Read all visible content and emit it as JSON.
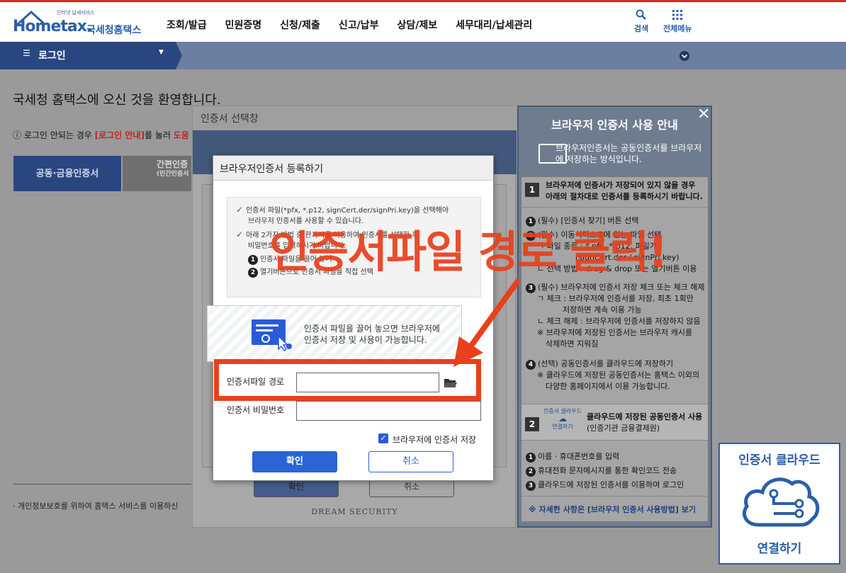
{
  "header": {
    "logo_small": "인터넷 납세서비스",
    "logo_main": "Hometax.",
    "logo_sub": "국세청홈택스",
    "nav": [
      "조회/발급",
      "민원증명",
      "신청/제출",
      "신고/납부",
      "상담/제보",
      "세무대리/납세관리"
    ],
    "search_label": "검색",
    "menu_label": "전체메뉴"
  },
  "subbar": {
    "login_label": "로그인"
  },
  "page": {
    "welcome": "국세청 홈택스에 오신 것을 환영합니다.",
    "info_pre": "로그인 안되는 경우 ",
    "info_link": "[로그인 안내]",
    "info_mid": "를 눌러 ",
    "info_red": "도움",
    "tab1": "공동·금융인증서",
    "tab2_line1": "간편인증",
    "tab2_line2": "(민간인증서",
    "privacy": "개인정보보호를 위하여 홈택스 서비스를 이용하신"
  },
  "cert_window": {
    "title": "인증서 선택창",
    "ghost_ok": "확인",
    "ghost_cancel": "취소",
    "vendor": "DREAM SECURITY"
  },
  "guide": {
    "title": "브라우저 인증서 사용 안내",
    "subtitle": "브라우저인증서는 공동인증서를 브라우저에 저장하는 방식입니다.",
    "sec1_num": "1",
    "sec1_text": [
      "브라우저에 인증서가 저장되어 있지 않을 경우",
      "아래의 절차대로 인증서를 등록하시기 바랍니다."
    ],
    "steps": [
      "(필수) [인증서 찾기] 버튼 선택",
      "(필수) 이동식디스크에 있는 파일 선택",
      "ㄱ 파일 종류 : *.pfx, *.p12, 파일가",
      "(signCert.der / signPri.key)",
      "ㄴ 선택 방법 : drag & drop 또는 열기버튼 이용",
      "(필수) 브라우저에 인증서 저장 체크 또는 체크 해제",
      "ㄱ 체크 : 브라우저에 인증서를 저장, 최초 1회만",
      "저장하면 계속 이용 가능",
      "ㄴ 체크 해제 : 브라우저에 인증서를 저장하지 않음",
      "※ 브라우저에 저장된 인증서는 브라우저 캐시를",
      "삭제하면 지워짐",
      "(선택) 공동인증서를 클라우드에 저장하기",
      "※ 클라우드에 저장된 공동인증서는 홈택스 이외의",
      "다양한 홈페이지에서 이용 가능합니다."
    ],
    "sec2_num": "2",
    "sec2_badge_top": "인증서 클라우드",
    "sec2_badge_bottom": "연결하기",
    "sec2_text": [
      "클라우드에 저장된 공동인증서 사용",
      "(인증기관 금융결제원)"
    ],
    "sec2_steps": [
      "이름 · 휴대폰번호를 입력",
      "휴대전화 문자메시지를 통한 확인코드 전송",
      "클라우드에 저장된 인증서를 이용하여 로그인"
    ],
    "footer": "※ 자세한 사항은 [브라우저 인증서 사용방법] 보기"
  },
  "dialog": {
    "title": "브라우저인증서 등록하기",
    "note1": [
      "인증서 파일(*pfx, *.p12, signCert.der/signPri.key)을 선택해야",
      "브라우저 인증서를 사용할 수 있습니다."
    ],
    "note2": [
      "아래 2가지 방법 중 한가지를 이용하여 인증서를 선택한 후",
      "비밀번호를 입력하시기 바랍니다."
    ],
    "sub1": "인증서 파일을 끌어 놓기",
    "sub2": "열기버튼으로 인증서 파일을 직접 선택",
    "drop_text": [
      "인증서 파일을 끌어 놓으면 브라우저에",
      "인증서 저장 및 사용이 가능합니다."
    ],
    "path_label": "인증서파일 경로",
    "pw_label": "인증서 비밀번호",
    "save_label": "브라우저에 인증서 저장",
    "ok": "확인",
    "cancel": "취소"
  },
  "annotation": {
    "text": "인증서파일 경로 클릭!",
    "color": "#e8401c"
  },
  "cloud": {
    "top": "인증서 클라우드",
    "bottom": "연결하기"
  }
}
